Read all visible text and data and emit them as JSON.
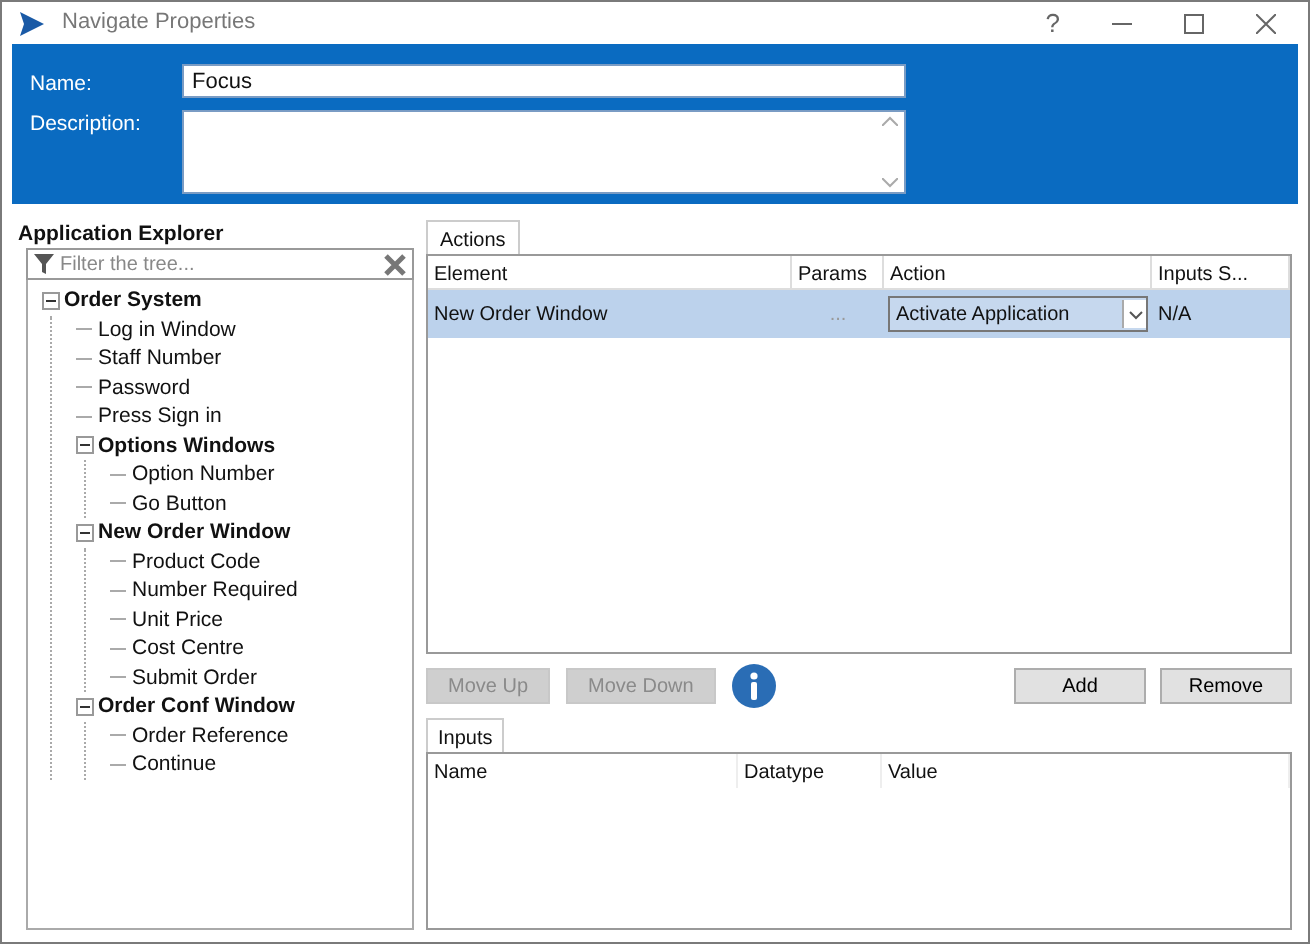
{
  "window": {
    "title": "Navigate Properties",
    "controls": [
      "?"
    ]
  },
  "header": {
    "name_label": "Name:",
    "name_value": "Focus",
    "description_label": "Description:"
  },
  "explorer": {
    "title": "Application Explorer",
    "filter": {
      "placeholder": "Filter the tree..."
    },
    "tree": [
      {
        "label": "Order System",
        "expanded": true,
        "children": [
          {
            "label": "Log in Window"
          },
          {
            "label": "Staff Number"
          },
          {
            "label": "Password"
          },
          {
            "label": "Press Sign in"
          },
          {
            "label": "Options Windows",
            "expanded": true,
            "children": [
              {
                "label": "Option Number"
              },
              {
                "label": "Go Button"
              }
            ]
          },
          {
            "label": "New Order Window",
            "expanded": true,
            "children": [
              {
                "label": "Product Code"
              },
              {
                "label": "Number Required"
              },
              {
                "label": "Unit Price"
              },
              {
                "label": "Cost Centre"
              },
              {
                "label": "Submit Order"
              }
            ]
          },
          {
            "label": "Order Conf Window",
            "expanded": true,
            "children": [
              {
                "label": "Order Reference"
              },
              {
                "label": "Continue"
              }
            ]
          }
        ]
      }
    ]
  },
  "actions": {
    "tab": "Actions",
    "columns": [
      "Element",
      "Params",
      "Action",
      "Inputs S..."
    ],
    "rows": [
      {
        "element": "New Order Window",
        "params": "...",
        "action": "Activate Application",
        "inputs": "N/A",
        "selected": true
      }
    ]
  },
  "buttons": [
    {
      "label": "Move Up",
      "disabled": true
    },
    {
      "label": "Move Down",
      "disabled": true
    },
    {
      "label": "Add",
      "disabled": false
    },
    {
      "label": "Remove",
      "disabled": false
    }
  ],
  "inputs": {
    "tab": "Inputs",
    "columns": [
      "Name",
      "Datatype",
      "Value"
    ]
  }
}
